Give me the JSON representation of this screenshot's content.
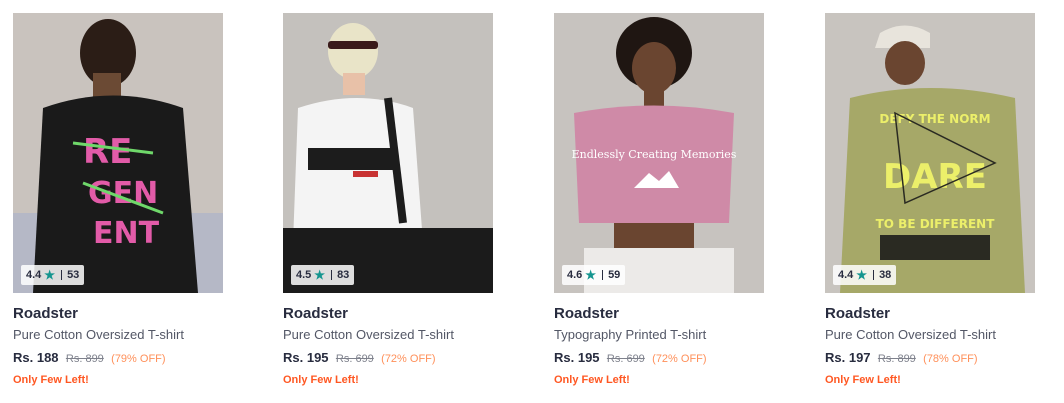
{
  "products": [
    {
      "brand": "Roadster",
      "name": "Pure Cotton Oversized T-shirt",
      "rating": "4.4",
      "rating_count": "53",
      "price": "Rs. 188",
      "mrp": "Rs. 899",
      "discount": "(79% OFF)",
      "stock": "Only Few Left!",
      "image": "model-black-back-graphic-tee"
    },
    {
      "brand": "Roadster",
      "name": "Pure Cotton Oversized T-shirt",
      "rating": "4.5",
      "rating_count": "83",
      "price": "Rs. 195",
      "mrp": "Rs. 699",
      "discount": "(72% OFF)",
      "stock": "Only Few Left!",
      "image": "model-white-printed-tee"
    },
    {
      "brand": "Roadster",
      "name": "Typography Printed T-shirt",
      "rating": "4.6",
      "rating_count": "59",
      "price": "Rs. 195",
      "mrp": "Rs. 699",
      "discount": "(72% OFF)",
      "stock": "Only Few Left!",
      "image": "model-pink-crop-tee"
    },
    {
      "brand": "Roadster",
      "name": "Pure Cotton Oversized T-shirt",
      "rating": "4.4",
      "rating_count": "38",
      "price": "Rs. 197",
      "mrp": "Rs. 899",
      "discount": "(78% OFF)",
      "stock": "Only Few Left!",
      "image": "model-olive-back-graphic-tee"
    }
  ],
  "colors": {
    "star": "#14958f",
    "discount": "#ff905a",
    "stock": "#ff5722"
  }
}
